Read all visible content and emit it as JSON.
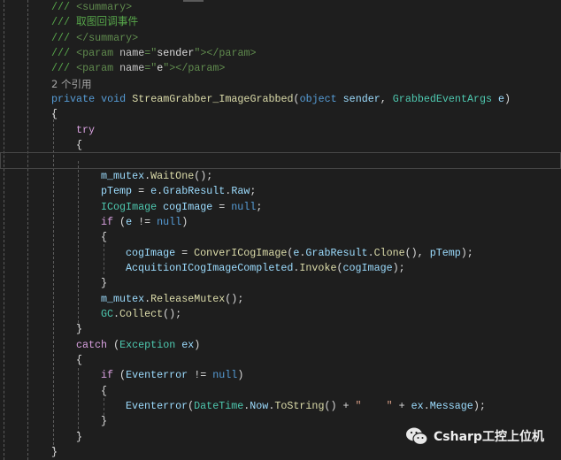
{
  "colors": {
    "background": "#1e1e1e",
    "comment": "#57a64a",
    "keyword": "#569cd6",
    "type": "#4ec9b0",
    "method": "#dcdcaa",
    "identifier": "#9cdcfe",
    "control": "#d8a0df"
  },
  "code_lines": [
    {
      "indent": 0,
      "tokens": [
        [
          "/// ",
          "comment"
        ],
        [
          "<summary>",
          "xmltag"
        ]
      ]
    },
    {
      "indent": 0,
      "tokens": [
        [
          "/// 取图回调事件",
          "comment"
        ]
      ]
    },
    {
      "indent": 0,
      "tokens": [
        [
          "/// ",
          "comment"
        ],
        [
          "</summary>",
          "xmltag"
        ]
      ]
    },
    {
      "indent": 0,
      "tokens": [
        [
          "/// ",
          "comment"
        ],
        [
          "<param ",
          "xmltag"
        ],
        [
          "name",
          "xmlattr"
        ],
        [
          "=\"",
          "xmltag"
        ],
        [
          "sender",
          "xmlstr"
        ],
        [
          "\"></param>",
          "xmltag"
        ]
      ]
    },
    {
      "indent": 0,
      "tokens": [
        [
          "/// ",
          "comment"
        ],
        [
          "<param ",
          "xmltag"
        ],
        [
          "name",
          "xmlattr"
        ],
        [
          "=\"",
          "xmltag"
        ],
        [
          "e",
          "xmlstr"
        ],
        [
          "\"></param>",
          "xmltag"
        ]
      ]
    },
    {
      "indent": 0,
      "tokens": [
        [
          "2 个引用",
          "ref"
        ]
      ]
    },
    {
      "indent": 0,
      "tokens": [
        [
          "private ",
          "kw"
        ],
        [
          "void ",
          "kw"
        ],
        [
          "StreamGrabber_ImageGrabbed",
          "method"
        ],
        [
          "(",
          "plain"
        ],
        [
          "object ",
          "kw"
        ],
        [
          "sender",
          "ident"
        ],
        [
          ", ",
          "plain"
        ],
        [
          "GrabbedEventArgs ",
          "type"
        ],
        [
          "e",
          "ident"
        ],
        [
          ")",
          "plain"
        ]
      ]
    },
    {
      "indent": 0,
      "tokens": [
        [
          "{",
          "plain"
        ]
      ]
    },
    {
      "indent": 1,
      "tokens": [
        [
          "try",
          "ctrl"
        ]
      ]
    },
    {
      "indent": 1,
      "tokens": [
        [
          "{",
          "plain"
        ]
      ]
    },
    {
      "indent": 2,
      "tokens": []
    },
    {
      "indent": 2,
      "tokens": [
        [
          "m_mutex",
          "ident"
        ],
        [
          ".",
          "plain"
        ],
        [
          "WaitOne",
          "method"
        ],
        [
          "();",
          "plain"
        ]
      ]
    },
    {
      "indent": 2,
      "tokens": [
        [
          "pTemp",
          "ident"
        ],
        [
          " = ",
          "plain"
        ],
        [
          "e",
          "ident"
        ],
        [
          ".",
          "plain"
        ],
        [
          "GrabResult",
          "ident"
        ],
        [
          ".",
          "plain"
        ],
        [
          "Raw",
          "ident"
        ],
        [
          ";",
          "plain"
        ]
      ]
    },
    {
      "indent": 2,
      "tokens": [
        [
          "ICogImage ",
          "type"
        ],
        [
          "cogImage",
          "ident"
        ],
        [
          " = ",
          "plain"
        ],
        [
          "null",
          "kw"
        ],
        [
          ";",
          "plain"
        ]
      ]
    },
    {
      "indent": 2,
      "tokens": [
        [
          "if ",
          "ctrl"
        ],
        [
          "(",
          "plain"
        ],
        [
          "e",
          "ident"
        ],
        [
          " != ",
          "plain"
        ],
        [
          "null",
          "kw"
        ],
        [
          ")",
          "plain"
        ]
      ]
    },
    {
      "indent": 2,
      "tokens": [
        [
          "{",
          "plain"
        ]
      ]
    },
    {
      "indent": 3,
      "tokens": [
        [
          "cogImage",
          "ident"
        ],
        [
          " = ",
          "plain"
        ],
        [
          "ConverICogImage",
          "method"
        ],
        [
          "(",
          "plain"
        ],
        [
          "e",
          "ident"
        ],
        [
          ".",
          "plain"
        ],
        [
          "GrabResult",
          "ident"
        ],
        [
          ".",
          "plain"
        ],
        [
          "Clone",
          "method"
        ],
        [
          "(), ",
          "plain"
        ],
        [
          "pTemp",
          "ident"
        ],
        [
          ");",
          "plain"
        ]
      ]
    },
    {
      "indent": 3,
      "tokens": [
        [
          "AcquitionICogImageCompleted",
          "ident"
        ],
        [
          ".",
          "plain"
        ],
        [
          "Invoke",
          "method"
        ],
        [
          "(",
          "plain"
        ],
        [
          "cogImage",
          "ident"
        ],
        [
          ");",
          "plain"
        ]
      ]
    },
    {
      "indent": 2,
      "tokens": [
        [
          "}",
          "plain"
        ]
      ]
    },
    {
      "indent": 2,
      "tokens": [
        [
          "m_mutex",
          "ident"
        ],
        [
          ".",
          "plain"
        ],
        [
          "ReleaseMutex",
          "method"
        ],
        [
          "();",
          "plain"
        ]
      ]
    },
    {
      "indent": 2,
      "tokens": [
        [
          "GC",
          "type"
        ],
        [
          ".",
          "plain"
        ],
        [
          "Collect",
          "method"
        ],
        [
          "();",
          "plain"
        ]
      ]
    },
    {
      "indent": 1,
      "tokens": [
        [
          "}",
          "plain"
        ]
      ]
    },
    {
      "indent": 1,
      "tokens": [
        [
          "catch ",
          "ctrl"
        ],
        [
          "(",
          "plain"
        ],
        [
          "Exception ",
          "type"
        ],
        [
          "ex",
          "ident"
        ],
        [
          ")",
          "plain"
        ]
      ]
    },
    {
      "indent": 1,
      "tokens": [
        [
          "{",
          "plain"
        ]
      ]
    },
    {
      "indent": 2,
      "tokens": [
        [
          "if ",
          "ctrl"
        ],
        [
          "(",
          "plain"
        ],
        [
          "Eventerror",
          "ident"
        ],
        [
          " != ",
          "plain"
        ],
        [
          "null",
          "kw"
        ],
        [
          ")",
          "plain"
        ]
      ]
    },
    {
      "indent": 2,
      "tokens": [
        [
          "{",
          "plain"
        ]
      ]
    },
    {
      "indent": 3,
      "tokens": [
        [
          "Eventerror",
          "ident"
        ],
        [
          "(",
          "plain"
        ],
        [
          "DateTime",
          "type"
        ],
        [
          ".",
          "plain"
        ],
        [
          "Now",
          "ident"
        ],
        [
          ".",
          "plain"
        ],
        [
          "ToString",
          "method"
        ],
        [
          "() + ",
          "plain"
        ],
        [
          "\"    \"",
          "str"
        ],
        [
          " + ",
          "plain"
        ],
        [
          "ex",
          "ident"
        ],
        [
          ".",
          "plain"
        ],
        [
          "Message",
          "ident"
        ],
        [
          ");",
          "plain"
        ]
      ]
    },
    {
      "indent": 2,
      "tokens": [
        [
          "}",
          "plain"
        ]
      ]
    },
    {
      "indent": 1,
      "tokens": [
        [
          "}",
          "plain"
        ]
      ]
    },
    {
      "indent": 0,
      "tokens": [
        [
          "}",
          "plain"
        ]
      ]
    }
  ],
  "watermark": {
    "icon": "wechat-icon",
    "text": "Csharp工控上位机"
  }
}
